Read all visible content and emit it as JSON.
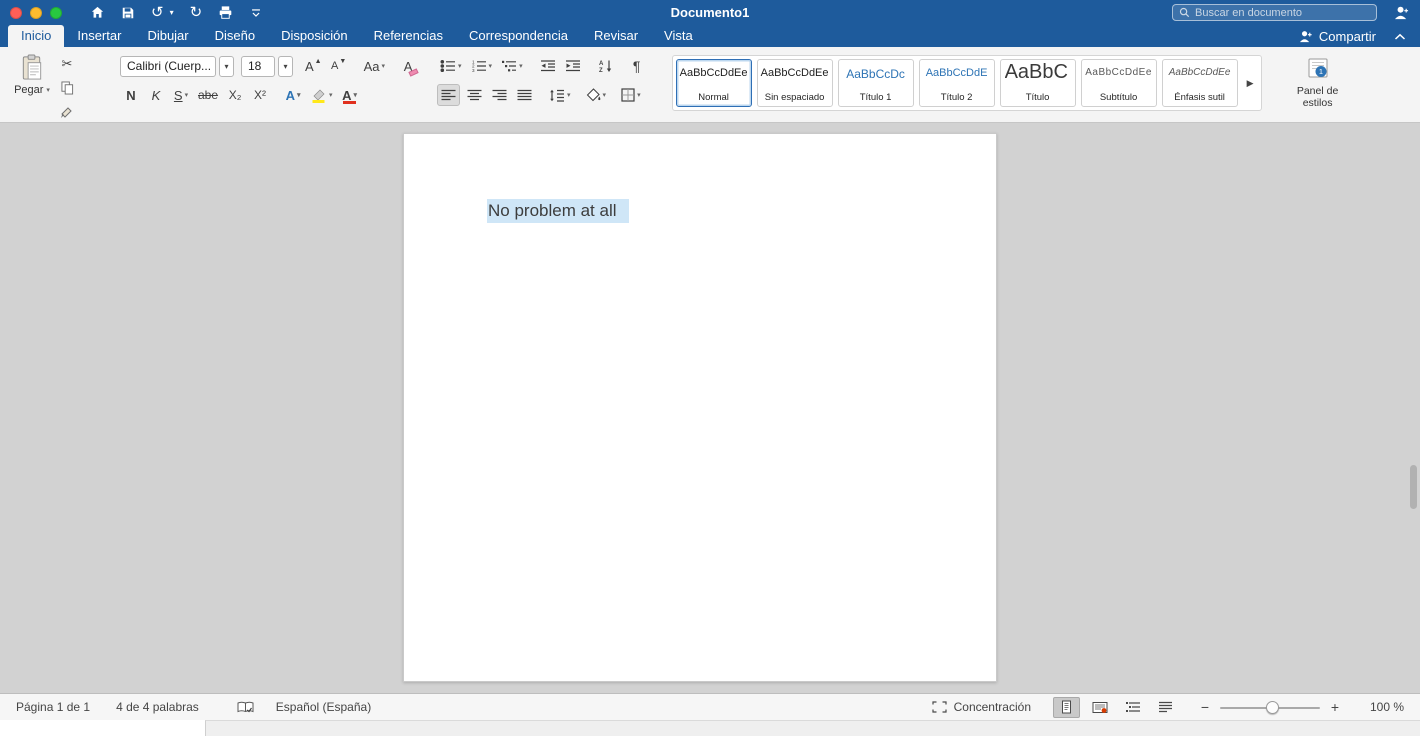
{
  "colors": {
    "titlebar_blue": "#1e5b9c",
    "accent_blue": "#2e74b5",
    "selection_blue": "#cfe6f7",
    "highlight_yellow": "#ffe81a",
    "font_color_red": "#e0301e"
  },
  "icons": {
    "dropdown": "▾",
    "undo": "↺",
    "redo": "↻",
    "scissors": "✂",
    "gallery_more": "▶",
    "zoom_minus": "−",
    "zoom_plus": "+",
    "grow_arrow": "▲",
    "shrink_arrow": "▼"
  },
  "titlebar": {
    "title": "Documento1",
    "search_placeholder": "Buscar en documento"
  },
  "tabs": [
    {
      "label": "Inicio"
    },
    {
      "label": "Insertar"
    },
    {
      "label": "Dibujar"
    },
    {
      "label": "Diseño"
    },
    {
      "label": "Disposición"
    },
    {
      "label": "Referencias"
    },
    {
      "label": "Correspondencia"
    },
    {
      "label": "Revisar"
    },
    {
      "label": "Vista"
    }
  ],
  "share_label": "Compartir",
  "ribbon": {
    "paste_label": "Pegar",
    "font_name": "Calibri (Cuerp...",
    "font_size": "18",
    "buttons": {
      "grow_font": "A",
      "shrink_font": "A",
      "change_case": "Aa",
      "clear_format": "A",
      "bold": "N",
      "italic": "K",
      "underline": "S",
      "strikethrough": "abe",
      "subscript": "X₂",
      "superscript": "X²",
      "text_effects": "A",
      "font_color": "A",
      "pilcrow": "¶"
    },
    "styles": [
      {
        "sample": "AaBbCcDdEe",
        "label": "Normal"
      },
      {
        "sample": "AaBbCcDdEe",
        "label": "Sin espaciado"
      },
      {
        "sample": "AaBbCcDc",
        "label": "Título 1"
      },
      {
        "sample": "AaBbCcDdE",
        "label": "Título 2"
      },
      {
        "sample": "AaBbC",
        "label": "Título"
      },
      {
        "sample": "AaBbCcDdEe",
        "label": "Subtítulo"
      },
      {
        "sample": "AaBbCcDdEe",
        "label": "Énfasis sutil"
      }
    ],
    "styles_pane_label": "Panel de estilos"
  },
  "document": {
    "text": "No problem at all"
  },
  "statusbar": {
    "page_count": "Página 1 de 1",
    "word_count": "4 de 4 palabras",
    "language": "Español (España)",
    "focus_label": "Concentración",
    "zoom_level": "100 %"
  }
}
